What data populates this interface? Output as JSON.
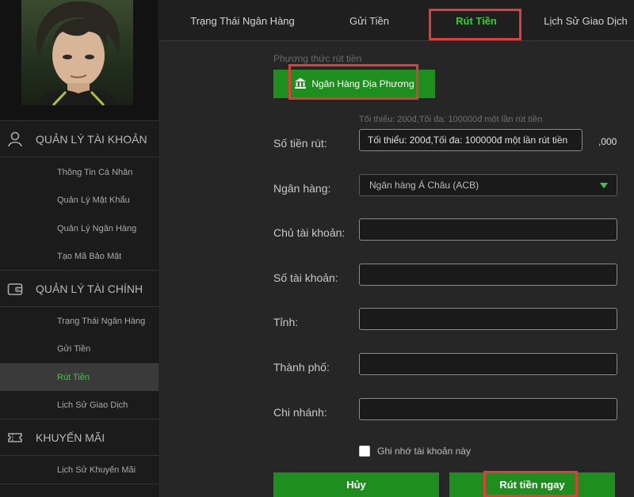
{
  "sidebar": {
    "sections": [
      {
        "label": "QUẢN LÝ TÀI KHOẢN",
        "icon": "user-icon"
      },
      {
        "label": "QUẢN LÝ TÀI CHÍNH",
        "icon": "wallet-icon"
      },
      {
        "label": "KHUYẾN MÃI",
        "icon": "ticket-icon"
      }
    ],
    "account_items": [
      "Thông Tin Cá Nhân",
      "Quản Lý Mật Khẩu",
      "Quản Lý Ngân Hàng",
      "Tạo Mã Bảo Mật"
    ],
    "finance_items": [
      "Trạng Thái Ngân Hàng",
      "Gửi Tiền",
      "Rút Tiền",
      "Lịch Sử Giao Dịch"
    ],
    "promo_items": [
      "Lịch Sử Khuyến Mãi"
    ],
    "active_item": "Rút Tiền"
  },
  "tabs": [
    "Trạng Thái Ngân Hàng",
    "Gửi Tiền",
    "Rút Tiền",
    "Lịch Sử Giao Dịch"
  ],
  "active_tab": "Rút Tiền",
  "form": {
    "method_label": "Phương thức rút tiền",
    "method_button": "Ngân Hàng Địa Phương",
    "amount_hint": "Tối thiểu: 200đ,Tối đa: 100000đ một lần rút tiền",
    "amount_label": "Số tiền rút:",
    "amount_placeholder": "Tối thiểu: 200đ,Tối đa: 100000đ một lần rút tiền",
    "amount_suffix": ",000",
    "bank_label": "Ngân hàng:",
    "bank_selected": "Ngân hàng Á Châu (ACB)",
    "holder_label": "Chủ tài khoản:",
    "account_number_label": "Số tài khoản:",
    "province_label": "Tỉnh:",
    "city_label": "Thành phố:",
    "branch_label": "Chi nhánh:",
    "remember_label": "Ghi nhớ tài khoản này",
    "cancel_button": "Hủy",
    "submit_button": "Rút tiền ngay"
  },
  "colors": {
    "accent": "#3ec93e",
    "button": "#1e8f1e",
    "highlight": "#e23b3b",
    "background": "#262626"
  }
}
